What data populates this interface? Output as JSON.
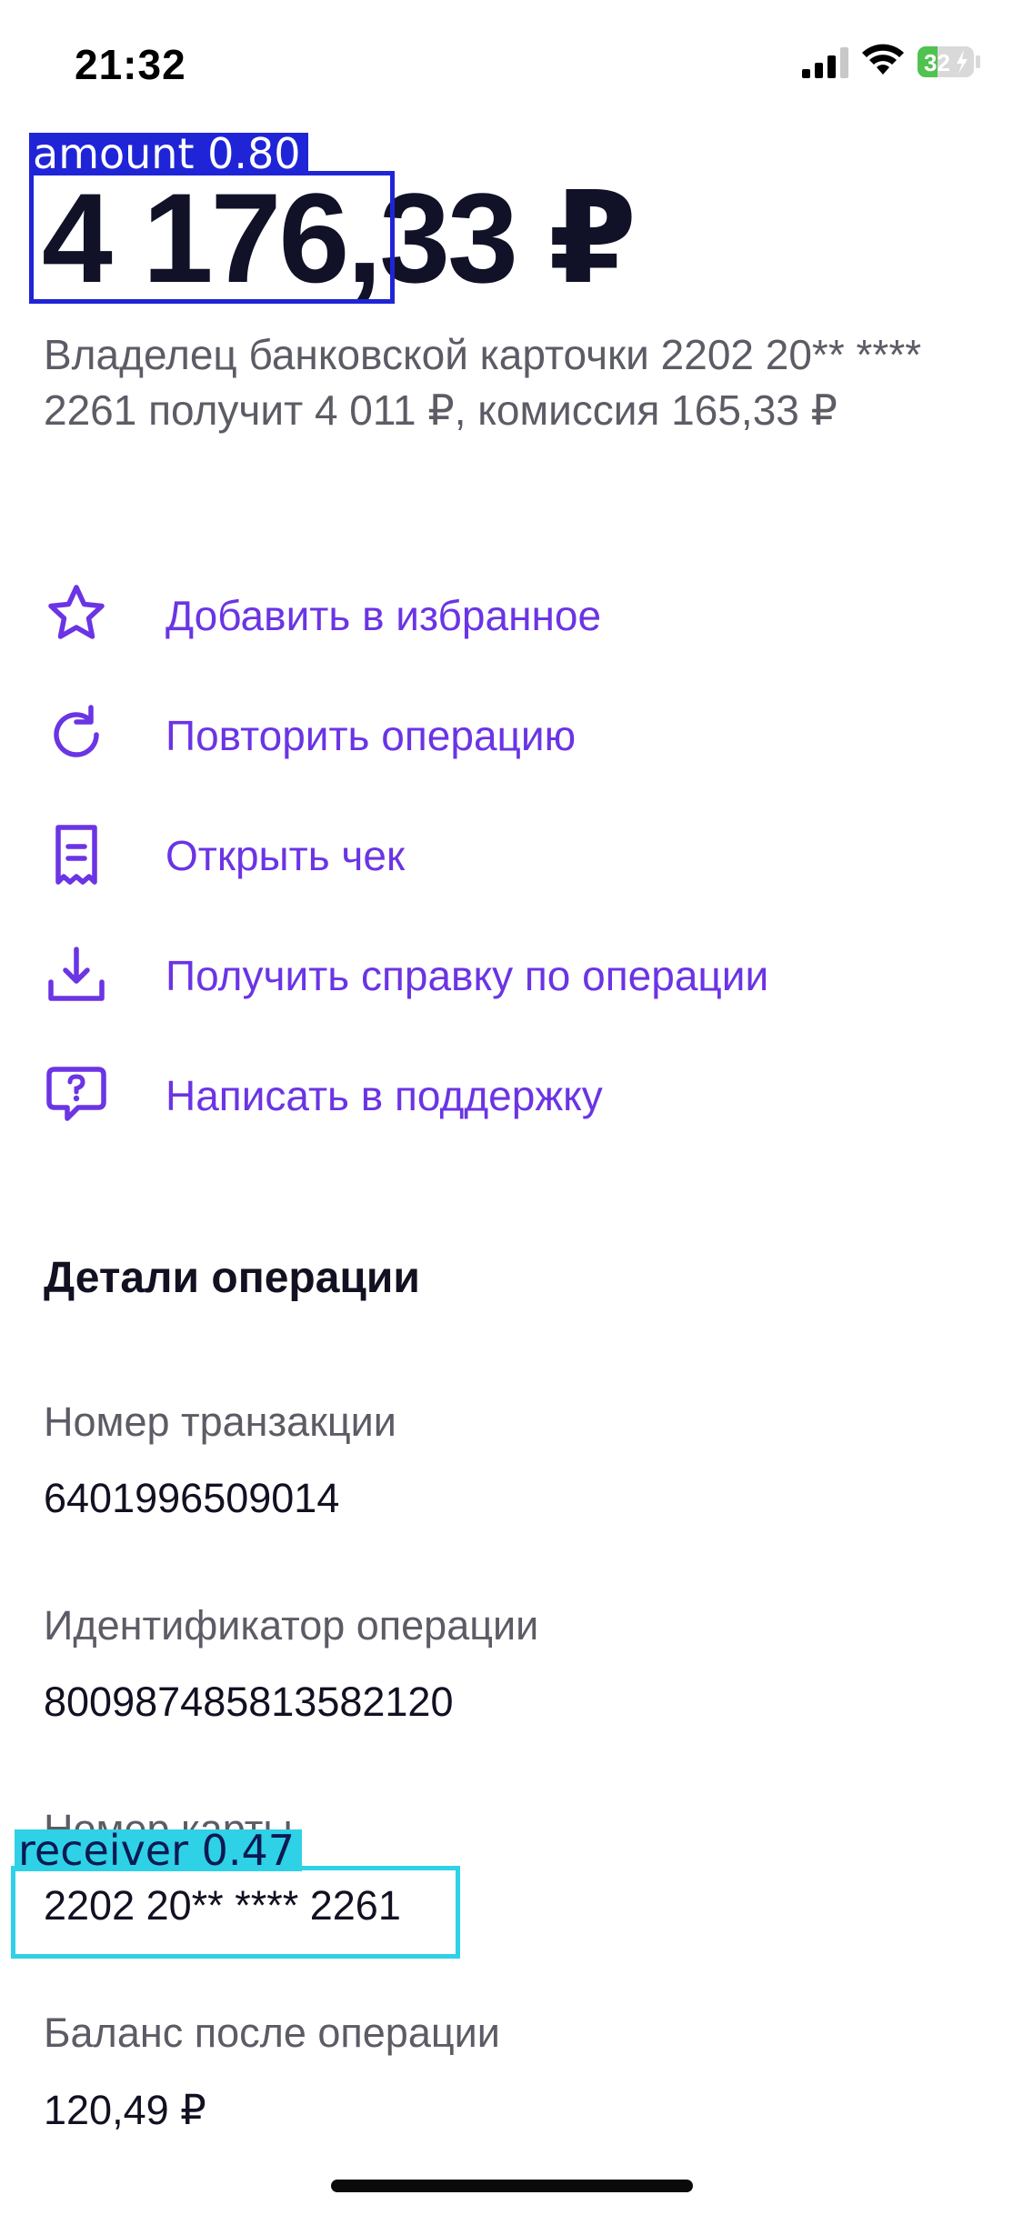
{
  "status_bar": {
    "time": "21:32",
    "battery": "32"
  },
  "operation": {
    "amount": "4 176,33 ₽",
    "description": "Владелец банковской карточки 2202 20** **** 2261 получит 4 011 ₽, комиссия 165,33 ₽"
  },
  "annotations": {
    "amount_label": "amount  0.80",
    "receiver_label": "receiver  0.47",
    "amount_color": "#1f25d6",
    "receiver_color": "#2fd1e6"
  },
  "actions": [
    {
      "label": "Добавить в избранное",
      "icon": "star-icon"
    },
    {
      "label": "Повторить операцию",
      "icon": "repeat-icon"
    },
    {
      "label": "Открыть чек",
      "icon": "receipt-icon"
    },
    {
      "label": "Получить справку по операции",
      "icon": "download-icon"
    },
    {
      "label": "Написать в поддержку",
      "icon": "support-chat-icon"
    }
  ],
  "details": {
    "title": "Детали операции",
    "transaction_number_label": "Номер транзакции",
    "transaction_number": "6401996509014",
    "operation_id_label": "Идентификатор операции",
    "operation_id": "800987485813582120",
    "card_number_label": "Номер карты",
    "card_number": "2202 20** **** 2261",
    "balance_label": "Баланс после операции",
    "balance": "120,49 ₽"
  },
  "colors": {
    "accent": "#6b34e4",
    "text_primary": "#111122",
    "text_secondary": "#5c5c66"
  }
}
